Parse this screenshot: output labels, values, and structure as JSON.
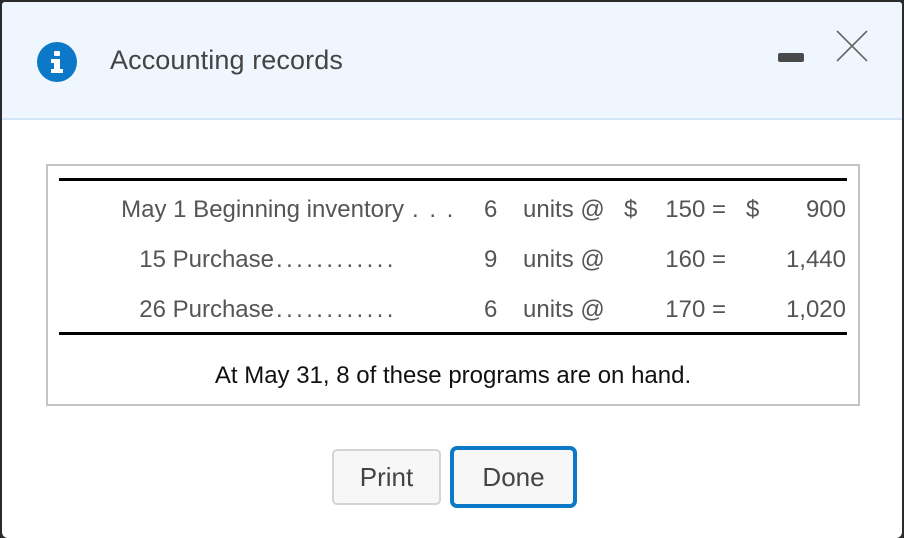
{
  "dialog": {
    "title": "Accounting records",
    "icon": "info-icon",
    "controls": {
      "minimize": "minimize-icon",
      "close": "close-icon"
    }
  },
  "table": {
    "rows": [
      {
        "label": "May 1 Beginning inventory",
        "dots": ". . .",
        "qty": "6",
        "unit": "units @",
        "dollar1": "$",
        "price": "150 =",
        "dollar2": "$",
        "total": "900"
      },
      {
        "label": "15 Purchase",
        "dots": "............",
        "qty": "9",
        "unit": "units @",
        "dollar1": "",
        "price": "160 =",
        "dollar2": "",
        "total": "1,440"
      },
      {
        "label": "26 Purchase",
        "dots": "............",
        "qty": "6",
        "unit": "units @",
        "dollar1": "",
        "price": "170 =",
        "dollar2": "",
        "total": "1,020"
      }
    ],
    "note": "At May 31, 8 of these programs are on hand."
  },
  "buttons": {
    "print": "Print",
    "done": "Done"
  },
  "colors": {
    "accent": "#0b78c8",
    "header_bg": "#f0f6fe"
  }
}
